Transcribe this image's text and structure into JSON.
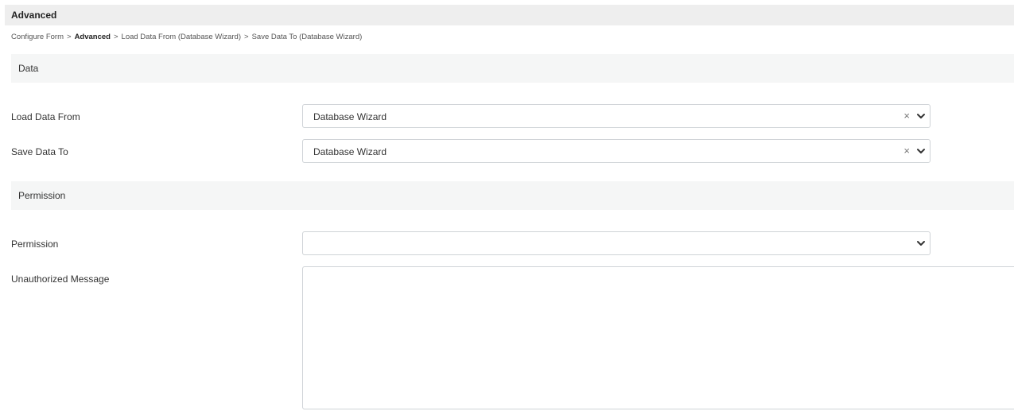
{
  "header": {
    "title": "Advanced"
  },
  "breadcrumb": {
    "items": [
      {
        "label": "Configure Form",
        "current": false
      },
      {
        "label": "Advanced",
        "current": true
      },
      {
        "label": "Load Data From (Database Wizard)",
        "current": false
      },
      {
        "label": "Save Data To (Database Wizard)",
        "current": false
      }
    ],
    "separator": ">"
  },
  "sections": {
    "data": {
      "title": "Data",
      "load_data_from": {
        "label": "Load Data From",
        "value": "Database Wizard",
        "clear_icon": "close-icon",
        "dropdown_icon": "chevron-down-icon"
      },
      "save_data_to": {
        "label": "Save Data To",
        "value": "Database Wizard",
        "clear_icon": "close-icon",
        "dropdown_icon": "chevron-down-icon"
      }
    },
    "permission": {
      "title": "Permission",
      "permission_field": {
        "label": "Permission",
        "value": "",
        "dropdown_icon": "chevron-down-icon"
      },
      "unauthorized_message": {
        "label": "Unauthorized Message",
        "value": ""
      }
    }
  },
  "glyphs": {
    "clear": "×"
  },
  "colors": {
    "title_bar_bg": "#eeeeee",
    "section_header_bg": "#f5f6f6",
    "input_border": "#cfd3d7"
  }
}
